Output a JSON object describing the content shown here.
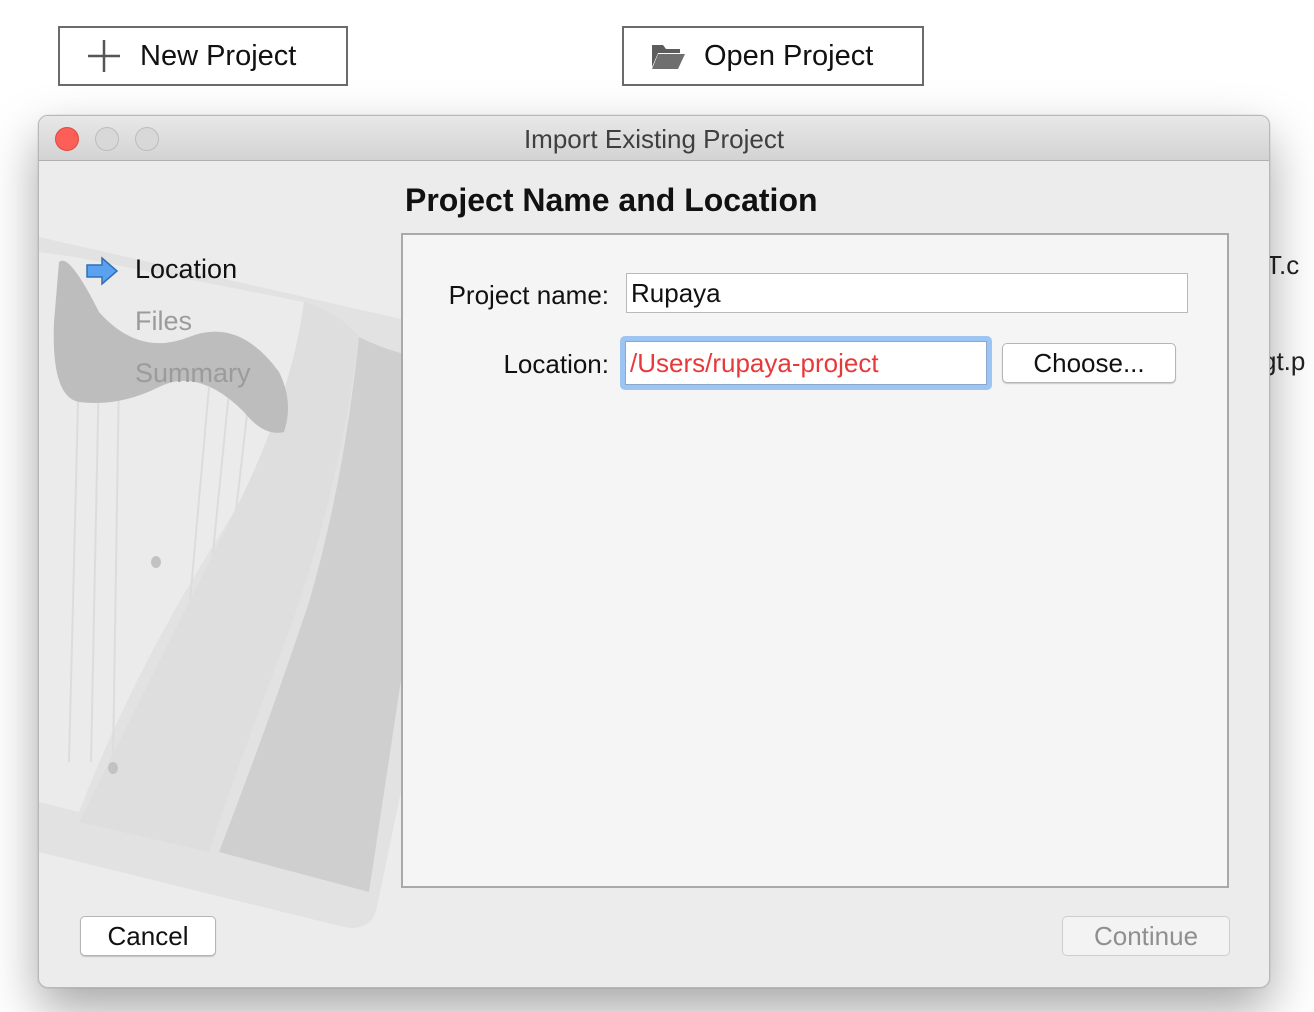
{
  "background": {
    "new_project_label": "New Project",
    "open_project_label": "Open Project",
    "fragment_1": "T.c",
    "fragment_2": "gt.p"
  },
  "dialog": {
    "title": "Import Existing Project",
    "steps": [
      {
        "label": "Location",
        "state": "active"
      },
      {
        "label": "Files",
        "state": "pending"
      },
      {
        "label": "Summary",
        "state": "pending"
      }
    ],
    "page_title": "Project Name and Location",
    "form": {
      "project_name_label": "Project name:",
      "project_name_value": "Rupaya",
      "location_label": "Location:",
      "location_value": "/Users/rupaya-project",
      "choose_label": "Choose..."
    },
    "buttons": {
      "cancel": "Cancel",
      "continue": "Continue"
    }
  },
  "colors": {
    "close_button": "#fc5f57",
    "invalid_path_text": "#e8393a",
    "focus_ring": "#9cc5f4",
    "step_arrow": "#4a90e2"
  },
  "icons": {
    "new_project": "plus-icon",
    "open_project": "folder-open-icon",
    "active_step": "arrow-right-icon"
  }
}
